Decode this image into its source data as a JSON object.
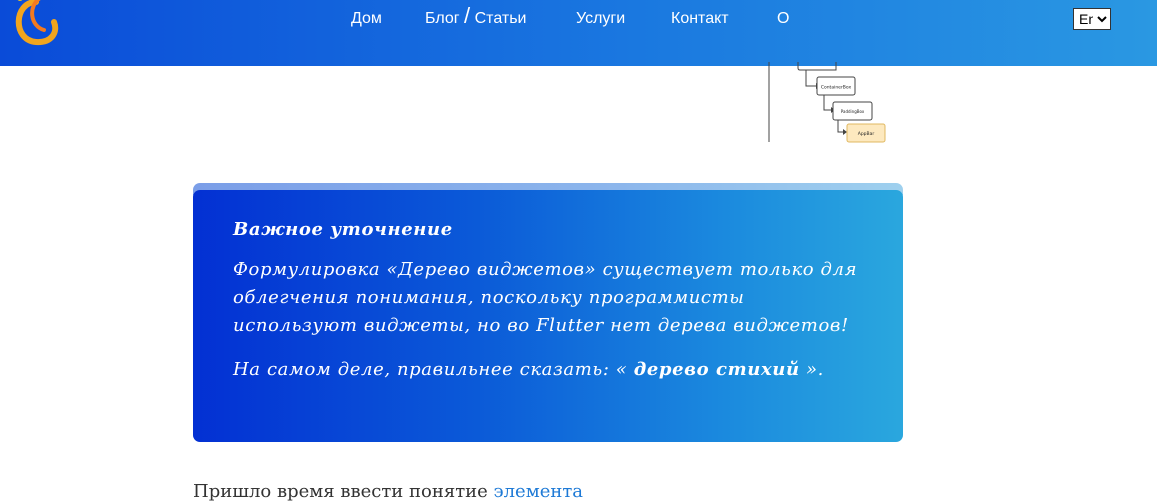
{
  "header": {
    "nav": [
      {
        "label": "Дом"
      },
      {
        "label_a": "Блог",
        "separator": "/",
        "label_b": "Статьи"
      },
      {
        "label": "Услуги"
      },
      {
        "label": "Контакт"
      },
      {
        "label": "О"
      }
    ],
    "language": {
      "selected": "En",
      "options": [
        "En"
      ]
    }
  },
  "tree": {
    "nodes": [
      "ContainerBox",
      "PaddingBox",
      "AppBar"
    ]
  },
  "callout": {
    "title": "Важное уточнение",
    "paragraph1": "Формулировка «Дерево виджетов» существует только для облегчения понимания, поскольку программисты используют виджеты, но во Flutter нет дерева виджетов!",
    "paragraph2_before": "На самом деле, правильнее сказать: « ",
    "paragraph2_strong": "дерево стихий",
    "paragraph2_after": " »."
  },
  "body_text": {
    "text": "Пришло время ввести понятие ",
    "link": "элемента"
  },
  "colors": {
    "header_start": "#0a4bd8",
    "header_end": "#2a98e2",
    "card_start": "#0330d3",
    "card_end": "#2aa7de",
    "link": "#1e7ad6"
  }
}
